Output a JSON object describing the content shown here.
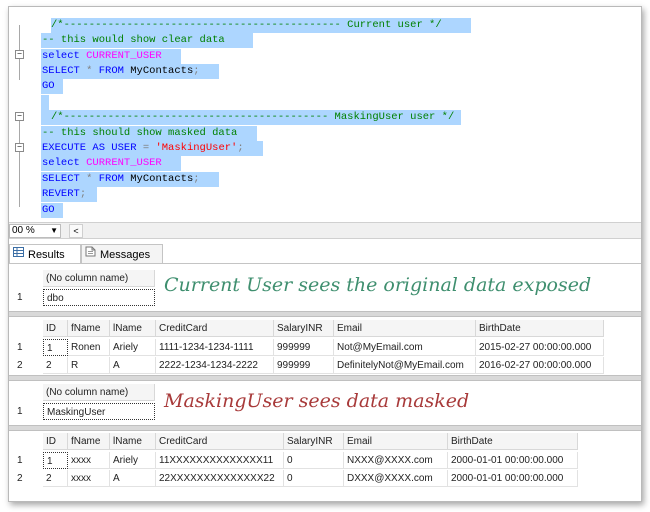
{
  "editor": {
    "lines": [
      [
        {
          "c": "cm",
          "t": "/*-------------------------------------------- Current user */"
        }
      ],
      [
        {
          "c": "cm",
          "t": "-- this would show clear data"
        }
      ],
      [
        {
          "c": "kw",
          "t": "select "
        },
        {
          "c": "fn",
          "t": "CURRENT_USER"
        }
      ],
      [
        {
          "c": "kw",
          "t": "SELECT "
        },
        {
          "c": "op",
          "t": "* "
        },
        {
          "c": "kw",
          "t": "FROM "
        },
        {
          "c": "tx",
          "t": "MyContacts"
        },
        {
          "c": "op",
          "t": ";"
        }
      ],
      [
        {
          "c": "kw",
          "t": "GO"
        }
      ],
      [
        {
          "c": "tx",
          "t": ""
        }
      ],
      [
        {
          "c": "cm",
          "t": "/*------------------------------------------ MaskingUser user */"
        }
      ],
      [
        {
          "c": "cm",
          "t": "-- this should show masked data"
        }
      ],
      [
        {
          "c": "kw",
          "t": "EXECUTE AS USER "
        },
        {
          "c": "op",
          "t": "= "
        },
        {
          "c": "st",
          "t": "'MaskingUser'"
        },
        {
          "c": "op",
          "t": ";"
        }
      ],
      [
        {
          "c": "kw",
          "t": "select "
        },
        {
          "c": "fn",
          "t": "CURRENT_USER"
        }
      ],
      [
        {
          "c": "kw",
          "t": "SELECT "
        },
        {
          "c": "op",
          "t": "* "
        },
        {
          "c": "kw",
          "t": "FROM "
        },
        {
          "c": "tx",
          "t": "MyContacts"
        },
        {
          "c": "op",
          "t": ";"
        }
      ],
      [
        {
          "c": "kw",
          "t": "REVERT"
        },
        {
          "c": "op",
          "t": ";"
        }
      ],
      [
        {
          "c": "kw",
          "t": "GO"
        }
      ]
    ]
  },
  "zoom": {
    "value": "00 %",
    "scroll_left": "<"
  },
  "tabs": {
    "results": "Results",
    "messages": "Messages"
  },
  "grid1": {
    "header": "(No column name)",
    "row_num": "1",
    "value": "dbo"
  },
  "annotation1": {
    "text": "Current User sees the original data exposed",
    "color": "#3f8f6f"
  },
  "grid2": {
    "columns": [
      "ID",
      "fName",
      "lName",
      "CreditCard",
      "SalaryINR",
      "Email",
      "BirthDate"
    ],
    "rows": [
      [
        "1",
        "1",
        "Ronen",
        "Ariely",
        "1111-1234-1234-1111",
        "999999",
        "Not@MyEmail.com",
        "2015-02-27 00:00:00.000"
      ],
      [
        "2",
        "2",
        "R",
        "A",
        "2222-1234-1234-2222",
        "999999",
        "DefinitelyNot@MyEmail.com",
        "2016-02-27 00:00:00.000"
      ]
    ]
  },
  "grid3": {
    "header": "(No column name)",
    "row_num": "1",
    "value": "MaskingUser"
  },
  "annotation2": {
    "text": "MaskingUser sees data masked",
    "color": "#a83a3a"
  },
  "grid4": {
    "columns": [
      "ID",
      "fName",
      "lName",
      "CreditCard",
      "SalaryINR",
      "Email",
      "BirthDate"
    ],
    "rows": [
      [
        "1",
        "1",
        "xxxx",
        "Ariely",
        "11XXXXXXXXXXXXXX11",
        "0",
        "NXXX@XXXX.com",
        "2000-01-01 00:00:00.000"
      ],
      [
        "2",
        "2",
        "xxxx",
        "A",
        "22XXXXXXXXXXXXXX22",
        "0",
        "DXXX@XXXX.com",
        "2000-01-01 00:00:00.000"
      ]
    ]
  }
}
